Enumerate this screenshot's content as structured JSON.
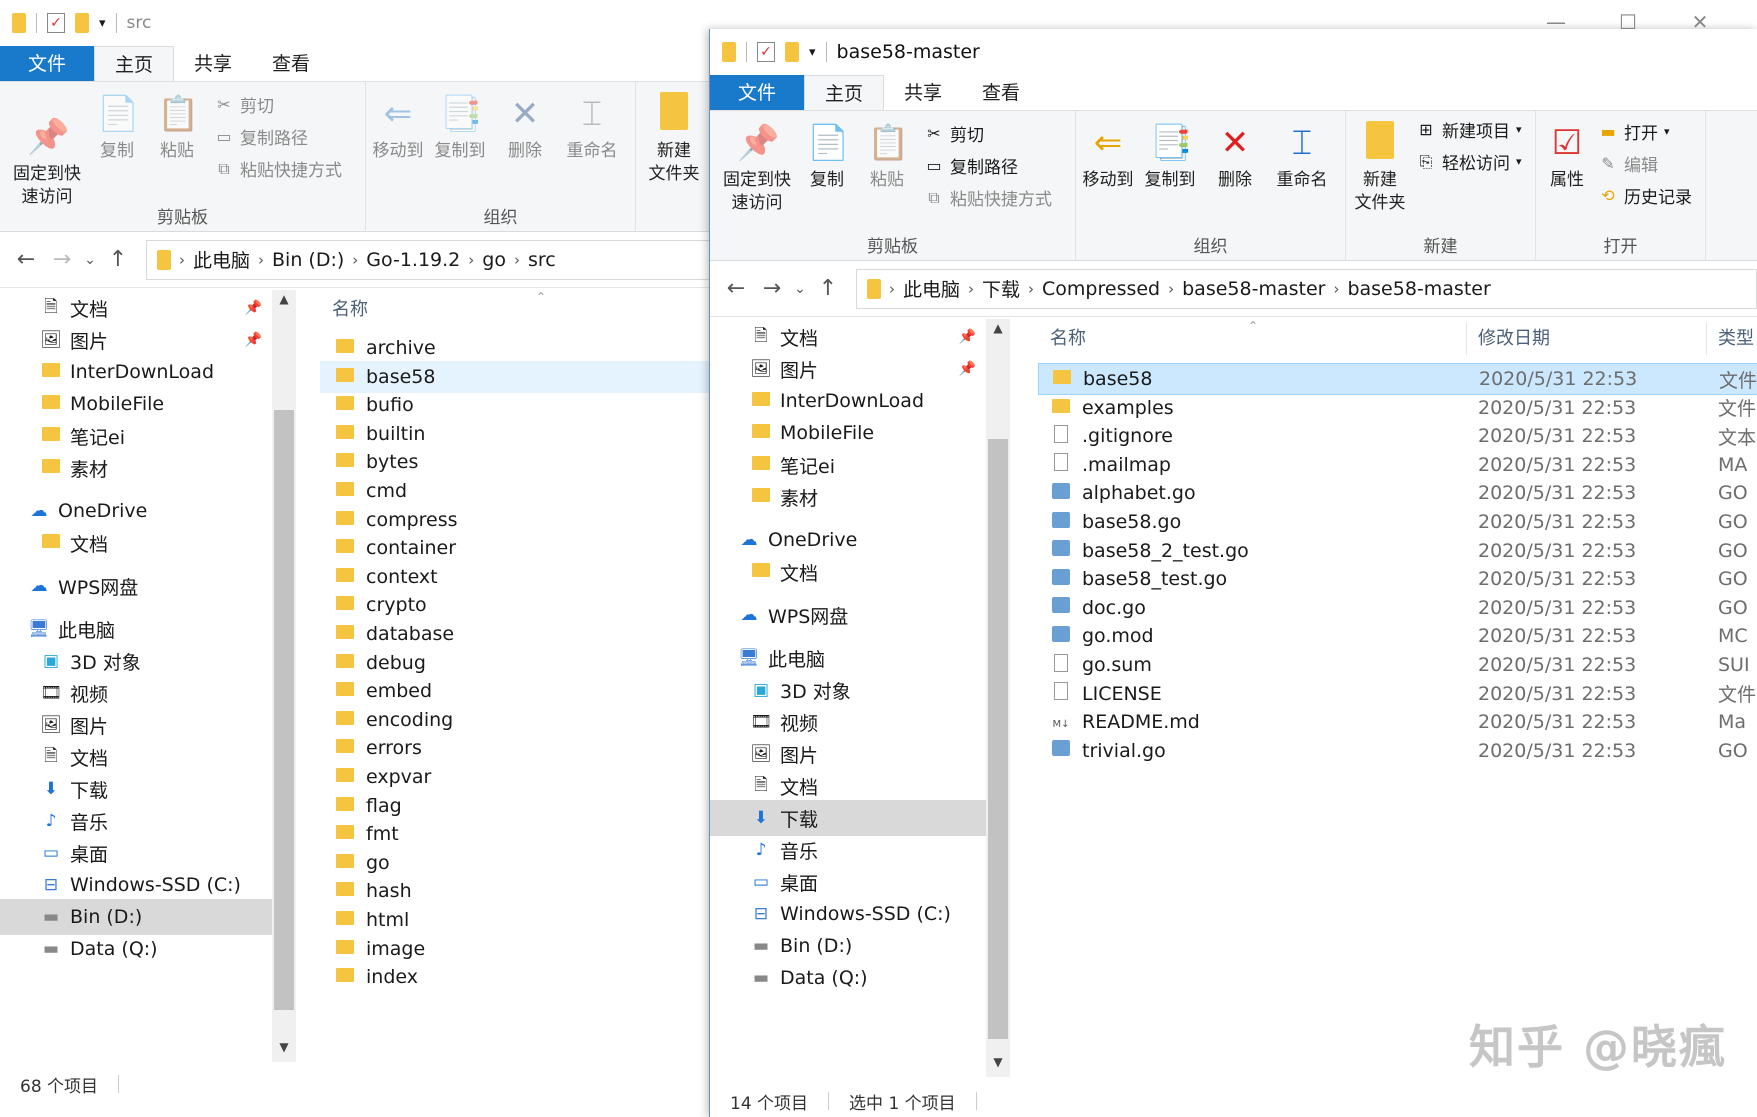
{
  "left_window": {
    "title": "src",
    "tabs": [
      "文件",
      "主页",
      "共享",
      "查看"
    ],
    "ribbon": {
      "clipboard": {
        "pin": "固定到快\n速访问",
        "copy": "复制",
        "paste": "粘贴",
        "cut": "剪切",
        "copy_path": "复制路径",
        "paste_shortcut": "粘贴快捷方式",
        "label": "剪贴板"
      },
      "organize": {
        "move_to": "移动到",
        "copy_to": "复制到",
        "delete": "删除",
        "rename": "重命名",
        "label": "组织"
      },
      "new": {
        "new_folder": "新建\n文件夹"
      }
    },
    "breadcrumb": [
      "此电脑",
      "Bin (D:)",
      "Go-1.19.2",
      "go",
      "src"
    ],
    "nav": [
      {
        "label": "文档",
        "icon": "document-icon",
        "pinned": true
      },
      {
        "label": "图片",
        "icon": "picture-icon",
        "pinned": true
      },
      {
        "label": "InterDownLoad",
        "icon": "folder-icon"
      },
      {
        "label": "MobileFile",
        "icon": "folder-icon"
      },
      {
        "label": "笔记ei",
        "icon": "folder-icon"
      },
      {
        "label": "素材",
        "icon": "folder-icon"
      },
      {
        "label": "OneDrive",
        "icon": "cloud-icon"
      },
      {
        "label": "文档",
        "icon": "folder-icon"
      },
      {
        "label": "WPS网盘",
        "icon": "cloud-outline-icon"
      },
      {
        "label": "此电脑",
        "icon": "computer-icon"
      },
      {
        "label": "3D 对象",
        "icon": "cube-icon"
      },
      {
        "label": "视频",
        "icon": "video-icon"
      },
      {
        "label": "图片",
        "icon": "picture-icon"
      },
      {
        "label": "文档",
        "icon": "document-icon"
      },
      {
        "label": "下载",
        "icon": "download-icon"
      },
      {
        "label": "音乐",
        "icon": "music-icon"
      },
      {
        "label": "桌面",
        "icon": "desktop-icon"
      },
      {
        "label": "Windows-SSD (C:)",
        "icon": "drive-windows-icon"
      },
      {
        "label": "Bin (D:)",
        "icon": "drive-icon",
        "selected": true
      },
      {
        "label": "Data (Q:)",
        "icon": "drive-icon"
      }
    ],
    "column_name": "名称",
    "files": [
      "archive",
      "base58",
      "bufio",
      "builtin",
      "bytes",
      "cmd",
      "compress",
      "container",
      "context",
      "crypto",
      "database",
      "debug",
      "embed",
      "encoding",
      "errors",
      "expvar",
      "flag",
      "fmt",
      "go",
      "hash",
      "html",
      "image",
      "index"
    ],
    "highlighted_file": "base58",
    "status": "68 个项目"
  },
  "right_window": {
    "title": "base58-master",
    "tabs": [
      "文件",
      "主页",
      "共享",
      "查看"
    ],
    "ribbon": {
      "clipboard": {
        "pin": "固定到快\n速访问",
        "copy": "复制",
        "paste": "粘贴",
        "cut": "剪切",
        "copy_path": "复制路径",
        "paste_shortcut": "粘贴快捷方式",
        "label": "剪贴板"
      },
      "organize": {
        "move_to": "移动到",
        "copy_to": "复制到",
        "delete": "删除",
        "rename": "重命名",
        "label": "组织"
      },
      "new": {
        "new_item": "新建项目",
        "easy_access": "轻松访问",
        "new_folder": "新建\n文件夹",
        "label": "新建"
      },
      "open": {
        "properties": "属性",
        "open": "打开",
        "edit": "编辑",
        "history": "历史记录",
        "label": "打开"
      }
    },
    "breadcrumb": [
      "此电脑",
      "下载",
      "Compressed",
      "base58-master",
      "base58-master"
    ],
    "nav": [
      {
        "label": "文档",
        "icon": "document-icon",
        "pinned": true
      },
      {
        "label": "图片",
        "icon": "picture-icon",
        "pinned": true
      },
      {
        "label": "InterDownLoad",
        "icon": "folder-icon"
      },
      {
        "label": "MobileFile",
        "icon": "folder-icon"
      },
      {
        "label": "笔记ei",
        "icon": "folder-icon"
      },
      {
        "label": "素材",
        "icon": "folder-icon"
      },
      {
        "label": "OneDrive",
        "icon": "cloud-icon"
      },
      {
        "label": "文档",
        "icon": "folder-icon"
      },
      {
        "label": "WPS网盘",
        "icon": "cloud-outline-icon"
      },
      {
        "label": "此电脑",
        "icon": "computer-icon"
      },
      {
        "label": "3D 对象",
        "icon": "cube-icon"
      },
      {
        "label": "视频",
        "icon": "video-icon"
      },
      {
        "label": "图片",
        "icon": "picture-icon"
      },
      {
        "label": "文档",
        "icon": "document-icon"
      },
      {
        "label": "下载",
        "icon": "download-icon",
        "selected": true
      },
      {
        "label": "音乐",
        "icon": "music-icon"
      },
      {
        "label": "桌面",
        "icon": "desktop-icon"
      },
      {
        "label": "Windows-SSD (C:)",
        "icon": "drive-windows-icon"
      },
      {
        "label": "Bin (D:)",
        "icon": "drive-icon"
      },
      {
        "label": "Data (Q:)",
        "icon": "drive-icon"
      }
    ],
    "columns": {
      "name": "名称",
      "date": "修改日期",
      "type": "类型"
    },
    "files": [
      {
        "name": "base58",
        "date": "2020/5/31 22:53",
        "type": "文件",
        "icon": "folder-icon",
        "selected": true
      },
      {
        "name": "examples",
        "date": "2020/5/31 22:53",
        "type": "文件",
        "icon": "folder-icon"
      },
      {
        "name": ".gitignore",
        "date": "2020/5/31 22:53",
        "type": "文本",
        "icon": "text-file-icon"
      },
      {
        "name": ".mailmap",
        "date": "2020/5/31 22:53",
        "type": "MA",
        "icon": "blank-file-icon"
      },
      {
        "name": "alphabet.go",
        "date": "2020/5/31 22:53",
        "type": "GO",
        "icon": "go-file-icon"
      },
      {
        "name": "base58.go",
        "date": "2020/5/31 22:53",
        "type": "GO",
        "icon": "go-file-icon"
      },
      {
        "name": "base58_2_test.go",
        "date": "2020/5/31 22:53",
        "type": "GO",
        "icon": "go-file-icon"
      },
      {
        "name": "base58_test.go",
        "date": "2020/5/31 22:53",
        "type": "GO",
        "icon": "go-file-icon"
      },
      {
        "name": "doc.go",
        "date": "2020/5/31 22:53",
        "type": "GO",
        "icon": "go-file-icon"
      },
      {
        "name": "go.mod",
        "date": "2020/5/31 22:53",
        "type": "MC",
        "icon": "mod-file-icon"
      },
      {
        "name": "go.sum",
        "date": "2020/5/31 22:53",
        "type": "SUI",
        "icon": "blank-file-icon"
      },
      {
        "name": "LICENSE",
        "date": "2020/5/31 22:53",
        "type": "文件",
        "icon": "blank-file-icon"
      },
      {
        "name": "README.md",
        "date": "2020/5/31 22:53",
        "type": "Ma",
        "icon": "markdown-file-icon"
      },
      {
        "name": "trivial.go",
        "date": "2020/5/31 22:53",
        "type": "GO",
        "icon": "go-file-icon"
      }
    ],
    "status": {
      "count": "14 个项目",
      "selected": "选中 1 个项目"
    }
  },
  "watermark": "知乎 @晓瘋"
}
